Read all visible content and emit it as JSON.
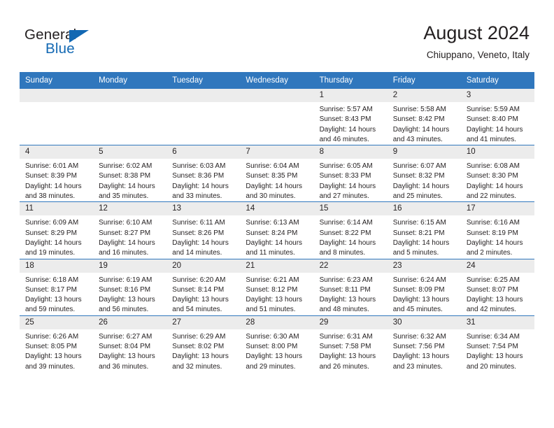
{
  "brand": {
    "name_dark": "General",
    "name_blue": "Blue",
    "accent_color": "#1268b3"
  },
  "header": {
    "title": "August 2024",
    "subtitle": "Chiuppano, Veneto, Italy",
    "header_bg_color": "#3077bd",
    "daynum_bg_color": "#ececec"
  },
  "weekdays": [
    "Sunday",
    "Monday",
    "Tuesday",
    "Wednesday",
    "Thursday",
    "Friday",
    "Saturday"
  ],
  "labels": {
    "sunrise_prefix": "Sunrise:",
    "sunset_prefix": "Sunset:",
    "daylight_prefix": "Daylight:"
  },
  "weeks": [
    [
      {
        "day": "",
        "empty": true
      },
      {
        "day": "",
        "empty": true
      },
      {
        "day": "",
        "empty": true
      },
      {
        "day": "",
        "empty": true
      },
      {
        "day": "1",
        "sunrise": "Sunrise: 5:57 AM",
        "sunset": "Sunset: 8:43 PM",
        "daylight1": "Daylight: 14 hours",
        "daylight2": "and 46 minutes."
      },
      {
        "day": "2",
        "sunrise": "Sunrise: 5:58 AM",
        "sunset": "Sunset: 8:42 PM",
        "daylight1": "Daylight: 14 hours",
        "daylight2": "and 43 minutes."
      },
      {
        "day": "3",
        "sunrise": "Sunrise: 5:59 AM",
        "sunset": "Sunset: 8:40 PM",
        "daylight1": "Daylight: 14 hours",
        "daylight2": "and 41 minutes."
      }
    ],
    [
      {
        "day": "4",
        "sunrise": "Sunrise: 6:01 AM",
        "sunset": "Sunset: 8:39 PM",
        "daylight1": "Daylight: 14 hours",
        "daylight2": "and 38 minutes."
      },
      {
        "day": "5",
        "sunrise": "Sunrise: 6:02 AM",
        "sunset": "Sunset: 8:38 PM",
        "daylight1": "Daylight: 14 hours",
        "daylight2": "and 35 minutes."
      },
      {
        "day": "6",
        "sunrise": "Sunrise: 6:03 AM",
        "sunset": "Sunset: 8:36 PM",
        "daylight1": "Daylight: 14 hours",
        "daylight2": "and 33 minutes."
      },
      {
        "day": "7",
        "sunrise": "Sunrise: 6:04 AM",
        "sunset": "Sunset: 8:35 PM",
        "daylight1": "Daylight: 14 hours",
        "daylight2": "and 30 minutes."
      },
      {
        "day": "8",
        "sunrise": "Sunrise: 6:05 AM",
        "sunset": "Sunset: 8:33 PM",
        "daylight1": "Daylight: 14 hours",
        "daylight2": "and 27 minutes."
      },
      {
        "day": "9",
        "sunrise": "Sunrise: 6:07 AM",
        "sunset": "Sunset: 8:32 PM",
        "daylight1": "Daylight: 14 hours",
        "daylight2": "and 25 minutes."
      },
      {
        "day": "10",
        "sunrise": "Sunrise: 6:08 AM",
        "sunset": "Sunset: 8:30 PM",
        "daylight1": "Daylight: 14 hours",
        "daylight2": "and 22 minutes."
      }
    ],
    [
      {
        "day": "11",
        "sunrise": "Sunrise: 6:09 AM",
        "sunset": "Sunset: 8:29 PM",
        "daylight1": "Daylight: 14 hours",
        "daylight2": "and 19 minutes."
      },
      {
        "day": "12",
        "sunrise": "Sunrise: 6:10 AM",
        "sunset": "Sunset: 8:27 PM",
        "daylight1": "Daylight: 14 hours",
        "daylight2": "and 16 minutes."
      },
      {
        "day": "13",
        "sunrise": "Sunrise: 6:11 AM",
        "sunset": "Sunset: 8:26 PM",
        "daylight1": "Daylight: 14 hours",
        "daylight2": "and 14 minutes."
      },
      {
        "day": "14",
        "sunrise": "Sunrise: 6:13 AM",
        "sunset": "Sunset: 8:24 PM",
        "daylight1": "Daylight: 14 hours",
        "daylight2": "and 11 minutes."
      },
      {
        "day": "15",
        "sunrise": "Sunrise: 6:14 AM",
        "sunset": "Sunset: 8:22 PM",
        "daylight1": "Daylight: 14 hours",
        "daylight2": "and 8 minutes."
      },
      {
        "day": "16",
        "sunrise": "Sunrise: 6:15 AM",
        "sunset": "Sunset: 8:21 PM",
        "daylight1": "Daylight: 14 hours",
        "daylight2": "and 5 minutes."
      },
      {
        "day": "17",
        "sunrise": "Sunrise: 6:16 AM",
        "sunset": "Sunset: 8:19 PM",
        "daylight1": "Daylight: 14 hours",
        "daylight2": "and 2 minutes."
      }
    ],
    [
      {
        "day": "18",
        "sunrise": "Sunrise: 6:18 AM",
        "sunset": "Sunset: 8:17 PM",
        "daylight1": "Daylight: 13 hours",
        "daylight2": "and 59 minutes."
      },
      {
        "day": "19",
        "sunrise": "Sunrise: 6:19 AM",
        "sunset": "Sunset: 8:16 PM",
        "daylight1": "Daylight: 13 hours",
        "daylight2": "and 56 minutes."
      },
      {
        "day": "20",
        "sunrise": "Sunrise: 6:20 AM",
        "sunset": "Sunset: 8:14 PM",
        "daylight1": "Daylight: 13 hours",
        "daylight2": "and 54 minutes."
      },
      {
        "day": "21",
        "sunrise": "Sunrise: 6:21 AM",
        "sunset": "Sunset: 8:12 PM",
        "daylight1": "Daylight: 13 hours",
        "daylight2": "and 51 minutes."
      },
      {
        "day": "22",
        "sunrise": "Sunrise: 6:23 AM",
        "sunset": "Sunset: 8:11 PM",
        "daylight1": "Daylight: 13 hours",
        "daylight2": "and 48 minutes."
      },
      {
        "day": "23",
        "sunrise": "Sunrise: 6:24 AM",
        "sunset": "Sunset: 8:09 PM",
        "daylight1": "Daylight: 13 hours",
        "daylight2": "and 45 minutes."
      },
      {
        "day": "24",
        "sunrise": "Sunrise: 6:25 AM",
        "sunset": "Sunset: 8:07 PM",
        "daylight1": "Daylight: 13 hours",
        "daylight2": "and 42 minutes."
      }
    ],
    [
      {
        "day": "25",
        "sunrise": "Sunrise: 6:26 AM",
        "sunset": "Sunset: 8:05 PM",
        "daylight1": "Daylight: 13 hours",
        "daylight2": "and 39 minutes."
      },
      {
        "day": "26",
        "sunrise": "Sunrise: 6:27 AM",
        "sunset": "Sunset: 8:04 PM",
        "daylight1": "Daylight: 13 hours",
        "daylight2": "and 36 minutes."
      },
      {
        "day": "27",
        "sunrise": "Sunrise: 6:29 AM",
        "sunset": "Sunset: 8:02 PM",
        "daylight1": "Daylight: 13 hours",
        "daylight2": "and 32 minutes."
      },
      {
        "day": "28",
        "sunrise": "Sunrise: 6:30 AM",
        "sunset": "Sunset: 8:00 PM",
        "daylight1": "Daylight: 13 hours",
        "daylight2": "and 29 minutes."
      },
      {
        "day": "29",
        "sunrise": "Sunrise: 6:31 AM",
        "sunset": "Sunset: 7:58 PM",
        "daylight1": "Daylight: 13 hours",
        "daylight2": "and 26 minutes."
      },
      {
        "day": "30",
        "sunrise": "Sunrise: 6:32 AM",
        "sunset": "Sunset: 7:56 PM",
        "daylight1": "Daylight: 13 hours",
        "daylight2": "and 23 minutes."
      },
      {
        "day": "31",
        "sunrise": "Sunrise: 6:34 AM",
        "sunset": "Sunset: 7:54 PM",
        "daylight1": "Daylight: 13 hours",
        "daylight2": "and 20 minutes."
      }
    ]
  ]
}
